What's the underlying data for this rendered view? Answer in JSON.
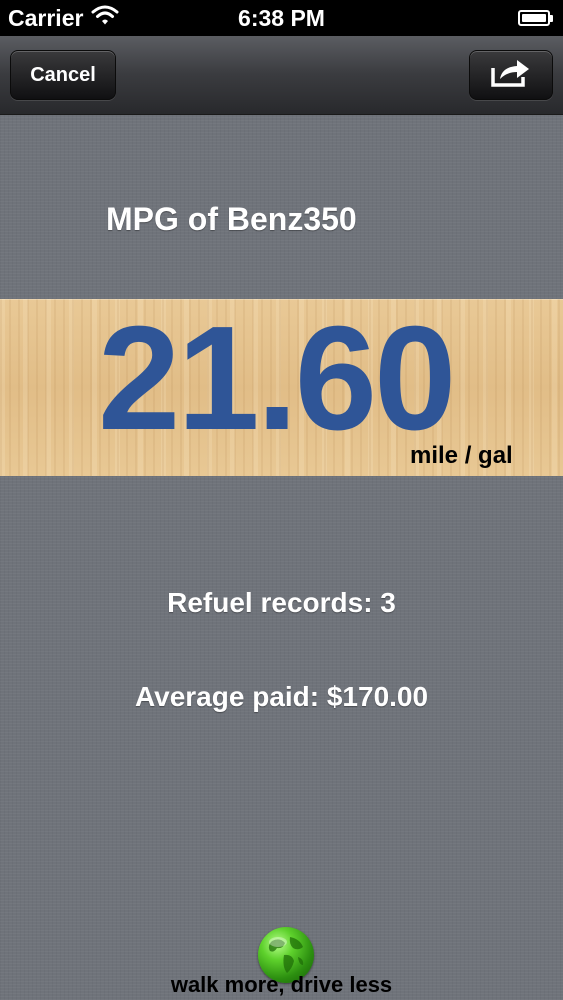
{
  "status_bar": {
    "carrier": "Carrier",
    "time": "6:38 PM",
    "icons": [
      "wifi-icon",
      "battery-icon"
    ]
  },
  "nav_bar": {
    "cancel_label": "Cancel",
    "share_icon": "share-icon"
  },
  "main": {
    "title": "MPG of Benz350",
    "mpg_value": "21.60",
    "unit": "mile / gal",
    "refuel_records": "Refuel records: 3",
    "average_paid": "Average paid: $170.00"
  },
  "footer": {
    "icon": "globe-icon",
    "slogan": "walk more, drive less"
  },
  "colors": {
    "mpg_value": "#2f5597",
    "wood_band": "#e5c391",
    "background": "#6f737a",
    "globe": "#3fae18"
  }
}
